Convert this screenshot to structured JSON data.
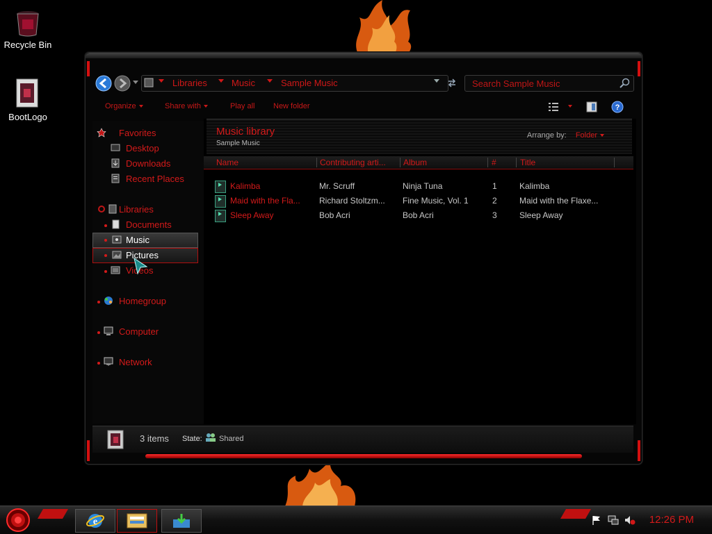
{
  "desktop": {
    "icons": [
      {
        "label": "Recycle Bin",
        "icon": "recycle-bin-icon"
      },
      {
        "label": "BootLogo",
        "icon": "bootlogo-icon"
      }
    ]
  },
  "explorer": {
    "breadcrumb": [
      "Libraries",
      "Music",
      "Sample Music"
    ],
    "search_placeholder": "Search Sample Music",
    "commands": {
      "organize": "Organize",
      "share_with": "Share with",
      "play_all": "Play all",
      "new_folder": "New folder"
    },
    "nav": {
      "favorites_header": "Favorites",
      "favorites": [
        "Desktop",
        "Downloads",
        "Recent Places"
      ],
      "libraries_header": "Libraries",
      "libraries": [
        "Documents",
        "Music",
        "Pictures",
        "Videos"
      ],
      "selected": "Music",
      "hovered": "Pictures",
      "homegroup": "Homegroup",
      "computer": "Computer",
      "network": "Network"
    },
    "library": {
      "title": "Music library",
      "subtitle": "Sample Music",
      "arrange_label": "Arrange by:",
      "arrange_value": "Folder"
    },
    "columns": [
      "Name",
      "Contributing arti...",
      "Album",
      "#",
      "Title"
    ],
    "files": [
      {
        "name": "Kalimba",
        "artist": "Mr. Scruff",
        "album": "Ninja Tuna",
        "track": "1",
        "title": "Kalimba",
        "type": "MP3"
      },
      {
        "name": "Maid with the Fla...",
        "artist": "Richard Stoltzm...",
        "album": "Fine Music, Vol. 1",
        "track": "2",
        "title": "Maid with the Flaxe...",
        "type": "MP3"
      },
      {
        "name": "Sleep Away",
        "artist": "Bob Acri",
        "album": "Bob Acri",
        "track": "3",
        "title": "Sleep Away",
        "type": "MP3"
      }
    ],
    "details": {
      "count": "3 items",
      "state_label": "State:",
      "state_value": "Shared"
    }
  },
  "taskbar": {
    "pinned": [
      "internet-explorer-icon",
      "windows-explorer-icon",
      "download-icon"
    ],
    "clock": "12:26 PM",
    "accent": "#d41a1a"
  }
}
